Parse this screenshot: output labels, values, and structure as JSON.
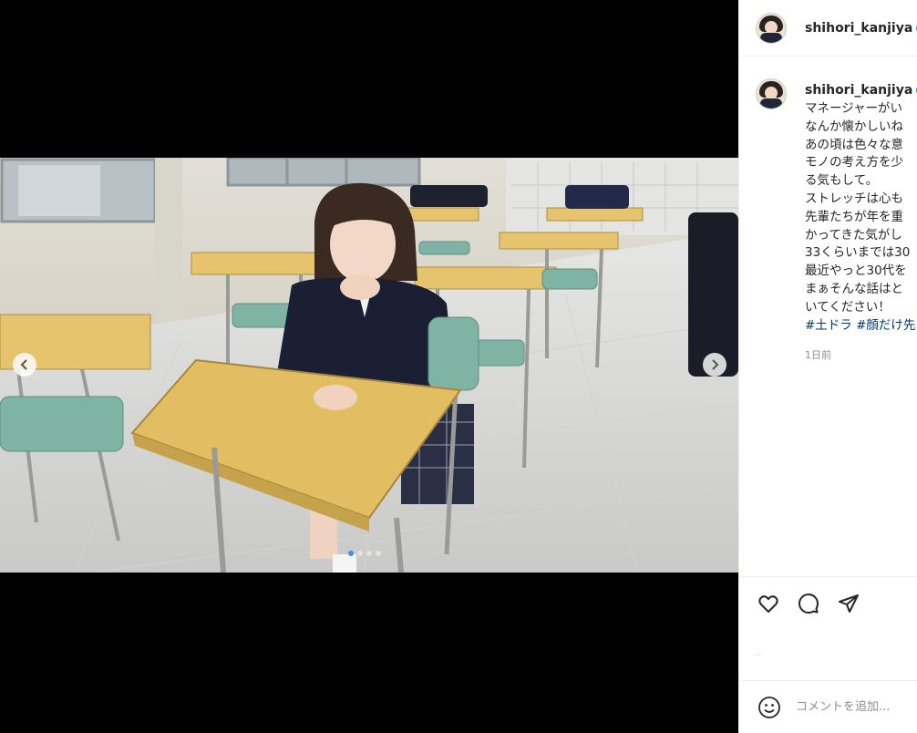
{
  "post": {
    "username": "shihori_kanjiya",
    "verified": true,
    "caption_lines": [
      "マネージャーがい",
      "なんか懐かしいね",
      "あの頃は色々な意",
      "モノの考え方を少",
      "る気もして。",
      "ストレッチは心も",
      "先輩たちが年を重",
      "かってきた気がし",
      "33くらいまでは30",
      "最近やっと30代を",
      "まぁそんな話はと",
      "いてください！"
    ],
    "hashtags": "#土ドラ #顔だけ先",
    "time_ago": "1日前",
    "likes_text": "..."
  },
  "carousel": {
    "slide_count": 4,
    "active_index": 0
  },
  "comment": {
    "placeholder": "コメントを追加..."
  },
  "colors": {
    "verified_blue": "#3897f0",
    "dot_active": "#3797f0",
    "text": "#262626",
    "muted": "#8e8e8e",
    "hashtag": "#00376b"
  },
  "icons": {
    "prev": "chevron-left-icon",
    "next": "chevron-right-icon",
    "like": "heart-icon",
    "comment": "comment-icon",
    "share": "paper-plane-icon",
    "emoji": "smiley-icon",
    "verified": "verified-badge-icon"
  }
}
